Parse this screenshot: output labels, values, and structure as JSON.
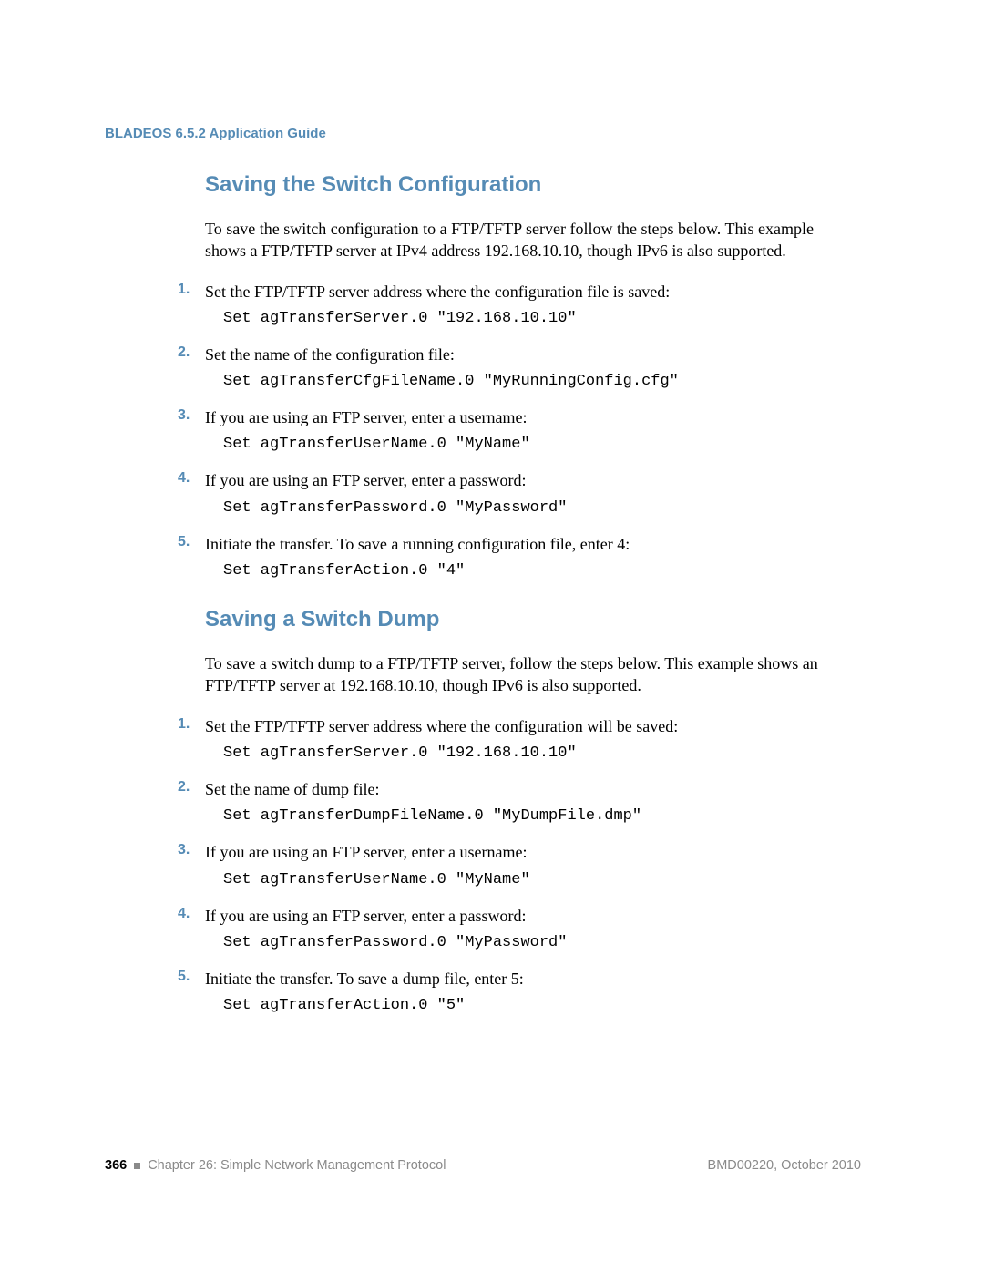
{
  "header": "BLADEOS 6.5.2 Application Guide",
  "section1": {
    "title": "Saving the Switch Configuration",
    "intro": "To save the switch configuration to a FTP/TFTP server follow the steps below. This example shows a FTP/TFTP server at IPv4 address 192.168.10.10, though IPv6 is also supported.",
    "steps": [
      {
        "num": "1.",
        "text": "Set the FTP/TFTP server address where the configuration file is saved:",
        "cmd": "Set agTransferServer.0 \"192.168.10.10\""
      },
      {
        "num": "2.",
        "text": "Set the name of the configuration file:",
        "cmd": "Set agTransferCfgFileName.0 \"MyRunningConfig.cfg\""
      },
      {
        "num": "3.",
        "text": "If you are using an FTP server, enter a username:",
        "cmd": "Set agTransferUserName.0 \"MyName\""
      },
      {
        "num": "4.",
        "text": "If you are using an FTP server, enter a password:",
        "cmd": "Set agTransferPassword.0 \"MyPassword\""
      },
      {
        "num": "5.",
        "text": "Initiate the transfer. To save a running configuration file, enter 4:",
        "cmd": "Set agTransferAction.0 \"4\""
      }
    ]
  },
  "section2": {
    "title": "Saving a Switch Dump",
    "intro": "To save a switch dump to a FTP/TFTP server, follow the steps below. This example shows an FTP/TFTP server at 192.168.10.10, though IPv6 is also supported.",
    "steps": [
      {
        "num": "1.",
        "text": "Set the FTP/TFTP server address where the configuration will be saved:",
        "cmd": "Set agTransferServer.0 \"192.168.10.10\""
      },
      {
        "num": "2.",
        "text": "Set the name of dump file:",
        "cmd": "Set agTransferDumpFileName.0 \"MyDumpFile.dmp\""
      },
      {
        "num": "3.",
        "text": "If you are using an FTP server, enter a username:",
        "cmd": "Set agTransferUserName.0 \"MyName\""
      },
      {
        "num": "4.",
        "text": "If you are using an FTP server, enter a password:",
        "cmd": "Set agTransferPassword.0 \"MyPassword\""
      },
      {
        "num": "5.",
        "text": "Initiate the transfer. To save a dump file, enter 5:",
        "cmd": "Set agTransferAction.0 \"5\""
      }
    ]
  },
  "footer": {
    "page": "366",
    "chapter": "Chapter 26: Simple Network Management Protocol",
    "right": "BMD00220, October 2010"
  }
}
